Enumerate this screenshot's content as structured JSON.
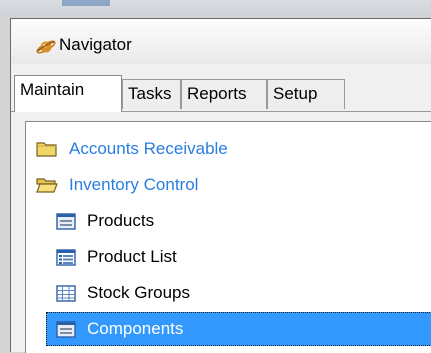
{
  "window": {
    "title": "Navigator",
    "title_icon": "planet-icon"
  },
  "tabs": [
    {
      "label": "Maintain",
      "active": true
    },
    {
      "label": "Tasks",
      "active": false
    },
    {
      "label": "Reports",
      "active": false
    },
    {
      "label": "Setup",
      "active": false
    }
  ],
  "tree": {
    "folders": [
      {
        "label": "Accounts Receivable",
        "icon": "folder-closed-icon",
        "expanded": false
      },
      {
        "label": "Inventory Control",
        "icon": "folder-open-icon",
        "expanded": true
      }
    ],
    "items": [
      {
        "label": "Products",
        "icon": "form-icon"
      },
      {
        "label": "Product List",
        "icon": "list-icon"
      },
      {
        "label": "Stock Groups",
        "icon": "grid-icon"
      },
      {
        "label": "Components",
        "icon": "form-icon",
        "selected": true
      }
    ]
  },
  "colors": {
    "folder_link": "#2a7de1",
    "selection": "#3399ff"
  }
}
